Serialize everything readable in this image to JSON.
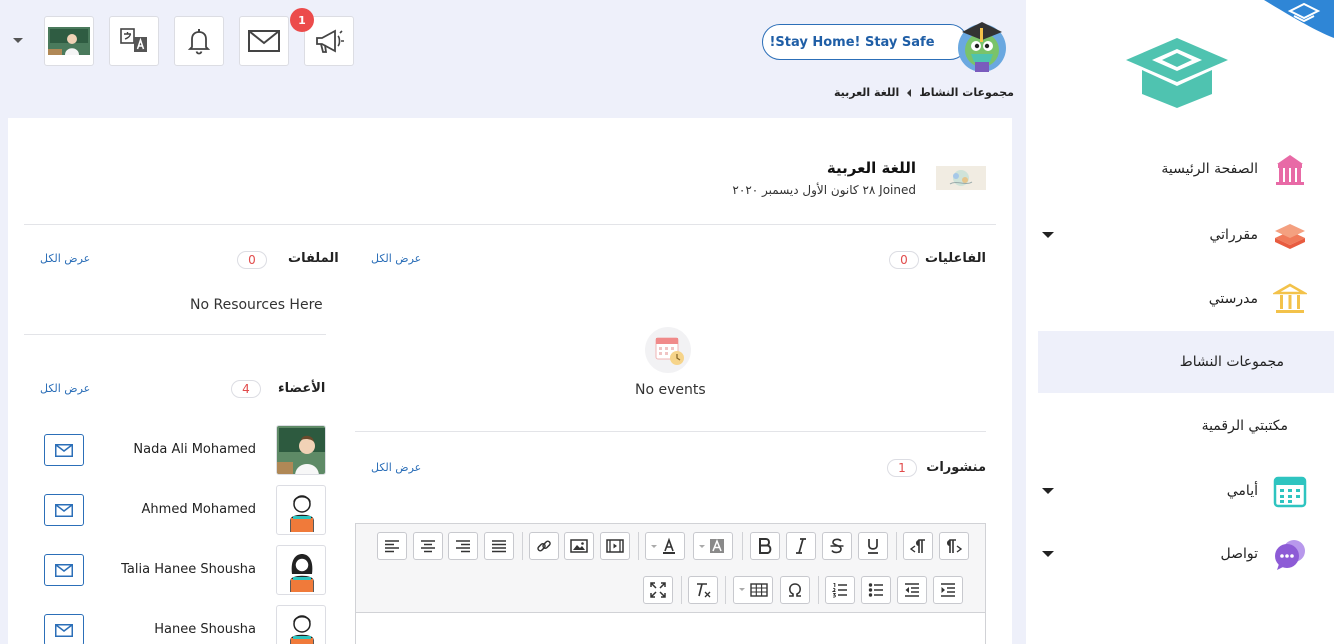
{
  "topbar": {
    "notification_count": "1",
    "banner_label": "!Stay Home! Stay Safe"
  },
  "breadcrumb": {
    "parent": "مجموعات النشاط",
    "current": "اللغة العربية"
  },
  "sidebar": {
    "items": [
      {
        "label": "الصفحة الرئيسية",
        "icon": "school-building-icon",
        "color": "#e86aa6"
      },
      {
        "label": "مقرراتي",
        "icon": "books-stack-icon",
        "color": "#f07a5a"
      },
      {
        "label": "مدرستي",
        "icon": "institution-columns-icon",
        "color": "#f3c24a"
      },
      {
        "label": "مجموعات النشاط"
      },
      {
        "label": "مكتبتي الرقمية"
      },
      {
        "label": "أيامي",
        "icon": "calendar-icon",
        "color": "#2ec4c0"
      },
      {
        "label": "تواصل",
        "icon": "chat-bubbles-icon",
        "color": "#8d5bd6"
      }
    ]
  },
  "group": {
    "title": "اللغة العربية",
    "joined_prefix": "Joined",
    "joined_date": "٢٨ كانون الأول ديسمبر ٢٠٢٠"
  },
  "events": {
    "title": "الفاعليات",
    "count": "0",
    "view_all": "عرض الكل",
    "empty": "No events"
  },
  "files": {
    "title": "الملفات",
    "count": "0",
    "view_all": "عرض الكل",
    "empty": "No Resources Here"
  },
  "members": {
    "title": "الأعضاء",
    "count": "4",
    "view_all": "عرض الكل",
    "list": [
      {
        "name": "Nada Ali Mohamed",
        "avatar": "teacher-photo"
      },
      {
        "name": "Ahmed Mohamed",
        "avatar": "boy-avatar"
      },
      {
        "name": "Talia Hanee Shousha",
        "avatar": "girl-avatar"
      },
      {
        "name": "Hanee Shousha",
        "avatar": "boy-avatar"
      }
    ]
  },
  "posts": {
    "title": "منشورات",
    "count": "1",
    "view_all": "عرض الكل"
  },
  "colors": {
    "accent_blue": "#2c6fb8",
    "badge_red": "#ec4b4b",
    "background": "#eef0fa",
    "logo_teal": "#4fc3b0"
  }
}
